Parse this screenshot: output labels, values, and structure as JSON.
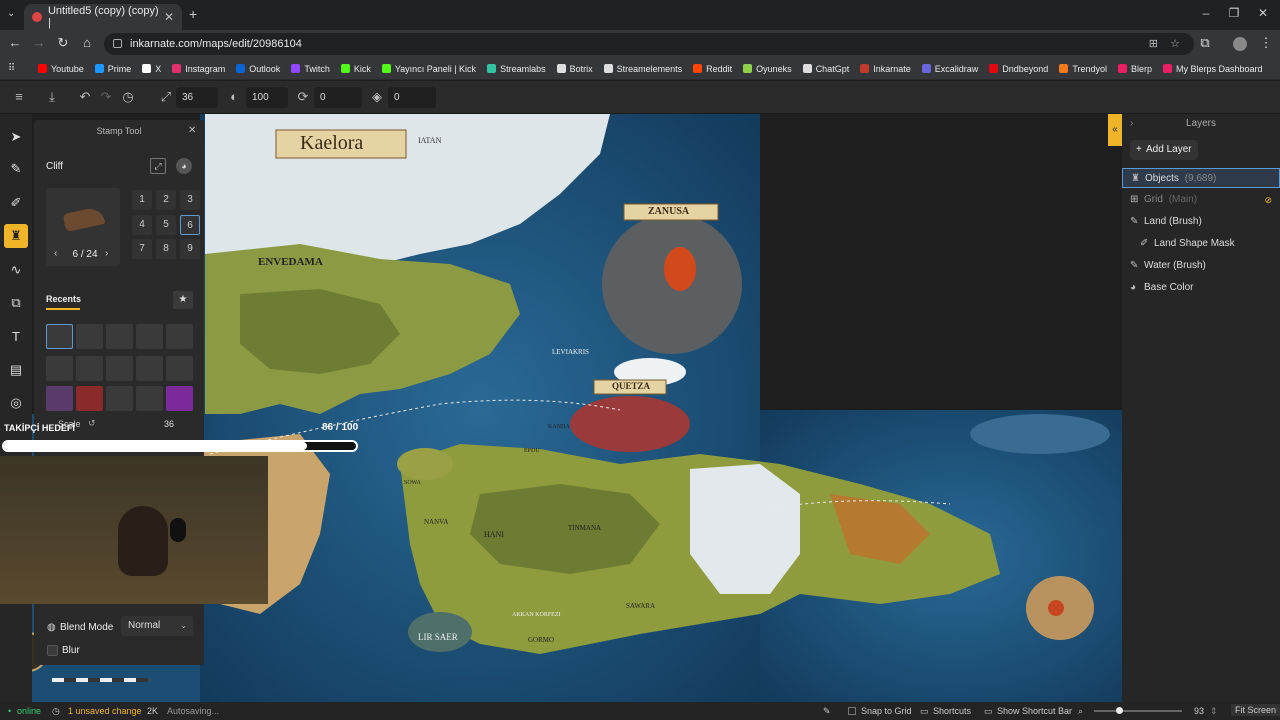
{
  "browser": {
    "tab_title": "Untitled5 (copy) (copy) |",
    "url": "inkarnate.com/maps/edit/20986104",
    "bookmarks": [
      {
        "label": "Youtube",
        "color": "#ff0000"
      },
      {
        "label": "Prime",
        "color": "#1a98ff"
      },
      {
        "label": "X",
        "color": "#ffffff"
      },
      {
        "label": "Instagram",
        "color": "#e1306c"
      },
      {
        "label": "Outlook",
        "color": "#0a64d6"
      },
      {
        "label": "Twitch",
        "color": "#9146ff"
      },
      {
        "label": "Kick",
        "color": "#53fc18"
      },
      {
        "label": "Yayıncı Paneli | Kick",
        "color": "#53fc18"
      },
      {
        "label": "Streamlabs",
        "color": "#31c3a2"
      },
      {
        "label": "Botrix",
        "color": "#dddddd"
      },
      {
        "label": "Streamelements",
        "color": "#dddddd"
      },
      {
        "label": "Reddit",
        "color": "#ff4500"
      },
      {
        "label": "Oyuneks",
        "color": "#8fd14f"
      },
      {
        "label": "ChatGpt",
        "color": "#dddddd"
      },
      {
        "label": "Inkarnate",
        "color": "#c0392b"
      },
      {
        "label": "Excalidraw",
        "color": "#6965db"
      },
      {
        "label": "Dndbeyond",
        "color": "#e40712"
      },
      {
        "label": "Trendyol",
        "color": "#f27a1a"
      },
      {
        "label": "Blerp",
        "color": "#e91e63"
      },
      {
        "label": "My Blerps Dashboard",
        "color": "#e91e63"
      }
    ]
  },
  "toolbar": {
    "size_value": "36",
    "opacity_value": "100",
    "rotation_value": "0",
    "layer_value": "0"
  },
  "stamp_panel": {
    "title": "Stamp Tool",
    "category": "Cliff",
    "page_indicator": "6 / 24",
    "numbers": [
      "1",
      "2",
      "3",
      "4",
      "5",
      "6",
      "7",
      "8",
      "9"
    ],
    "selected_number": "6",
    "recents_label": "Recents",
    "scale_label": "Scale",
    "scale_value": "36",
    "blend_mode_label": "Blend Mode",
    "blend_mode_value": "Normal",
    "blur_label": "Blur"
  },
  "overlay": {
    "follower_goal_label": "TAKİPÇİ HEDEFİ",
    "follower_progress": "86 / 100",
    "follower_fraction": 0.86
  },
  "map_labels": {
    "title_banner": "Kaelora",
    "zanusa": "ZANUSA",
    "quetza": "QUETZA",
    "envedama": "ENVEDAMA",
    "leviakris": "LEVIAKRIS",
    "iatan": "IATAN",
    "lir_saer": "LIR SAER",
    "hani": "HANI",
    "nanva": "NANVA",
    "sawara": "SAWARA",
    "gormo": "GORMO",
    "sowa": "SOWA",
    "epdu": "EPDU",
    "kanda": "KANDA",
    "akkan_korfezi": "AKKAN KORFEZI",
    "tinman": "TİNMANA"
  },
  "layers": {
    "header": "Layers",
    "add_layer": "Add Layer",
    "items": [
      {
        "name": "Objects",
        "meta": "(9,689)",
        "icon": "objects-icon"
      },
      {
        "name": "Grid",
        "meta": "(Main)",
        "icon": "grid-icon"
      },
      {
        "name": "Land (Brush)",
        "meta": "",
        "icon": "brush-icon"
      },
      {
        "name": "Land Shape Mask",
        "meta": "",
        "icon": "mask-icon"
      },
      {
        "name": "Water (Brush)",
        "meta": "",
        "icon": "brush-icon"
      },
      {
        "name": "Base Color",
        "meta": "",
        "icon": "palette-icon"
      }
    ]
  },
  "status": {
    "online": "online",
    "unsaved": "1 unsaved change",
    "resolution": "2K",
    "autosave": "Autosaving...",
    "snap_to_grid": "Snap to Grid",
    "shortcuts": "Shortcuts",
    "show_shortcut_bar": "Show Shortcut Bar",
    "zoom": "93",
    "fit_screen": "Fit Screen"
  },
  "colors": {
    "accent": "#f0b429",
    "selection": "#5b9bd5",
    "ocean": "#1b4f7a",
    "land": "#8a9a3a"
  }
}
